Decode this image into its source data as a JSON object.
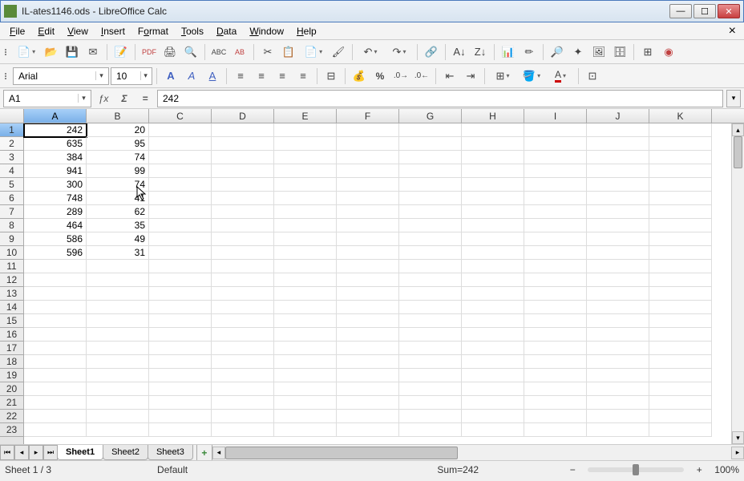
{
  "window": {
    "title": "IL-ates1146.ods - LibreOffice Calc"
  },
  "menu": {
    "file": "File",
    "edit": "Edit",
    "view": "View",
    "insert": "Insert",
    "format": "Format",
    "tools": "Tools",
    "data": "Data",
    "window": "Window",
    "help": "Help"
  },
  "format_toolbar": {
    "font_name": "Arial",
    "font_size": "10"
  },
  "cellref": {
    "value": "A1"
  },
  "formula": {
    "value": "242"
  },
  "columns": [
    "A",
    "B",
    "C",
    "D",
    "E",
    "F",
    "G",
    "H",
    "I",
    "J",
    "K"
  ],
  "rows": [
    1,
    2,
    3,
    4,
    5,
    6,
    7,
    8,
    9,
    10,
    11,
    12,
    13,
    14,
    15,
    16,
    17,
    18,
    19,
    20,
    21,
    22,
    23
  ],
  "cells": {
    "A": [
      "242",
      "635",
      "384",
      "941",
      "300",
      "748",
      "289",
      "464",
      "586",
      "596",
      "",
      "",
      "",
      "",
      "",
      "",
      "",
      "",
      "",
      "",
      "",
      "",
      ""
    ],
    "B": [
      "20",
      "95",
      "74",
      "99",
      "74",
      "41",
      "62",
      "35",
      "49",
      "31",
      "",
      "",
      "",
      "",
      "",
      "",
      "",
      "",
      "",
      "",
      "",
      "",
      ""
    ]
  },
  "tabs": {
    "items": [
      "Sheet1",
      "Sheet2",
      "Sheet3"
    ],
    "active": 0
  },
  "status": {
    "sheet": "Sheet 1 / 3",
    "style": "Default",
    "sum": "Sum=242",
    "zoom": "100%"
  },
  "active_cell": {
    "col": "A",
    "row": 1
  }
}
